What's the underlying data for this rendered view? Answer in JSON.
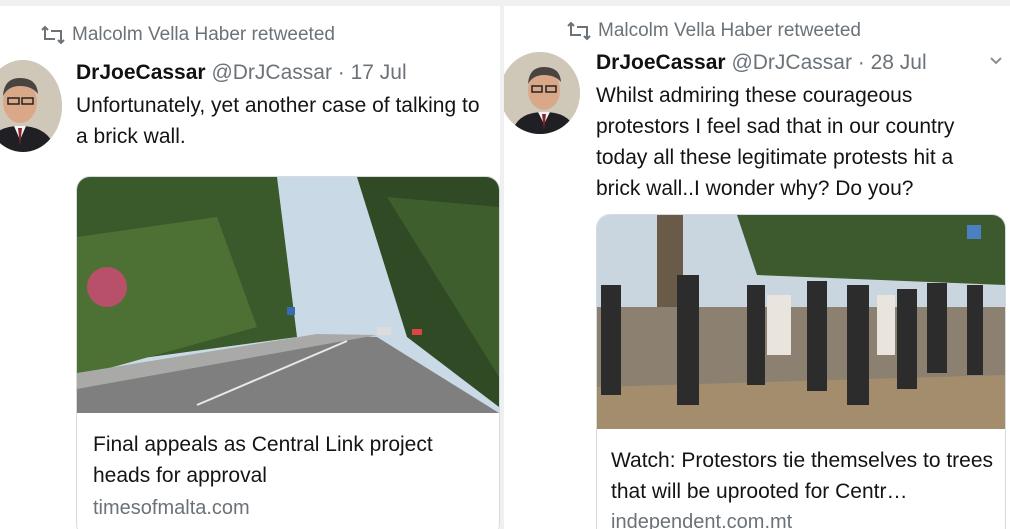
{
  "tweets": [
    {
      "retweet_label": "Malcolm Vella Haber retweeted",
      "author_name": "DrJoeCassar",
      "meta": "@DrJCassar · 17 Jul",
      "text": "Unfortunately, yet another case of talking to a brick wall.",
      "card": {
        "title": "Final appeals as Central Link project heads for approval",
        "domain": "timesofmalta.com"
      }
    },
    {
      "retweet_label": "Malcolm Vella Haber retweeted",
      "author_name": "DrJoeCassar",
      "meta": "@DrJCassar · 28 Jul",
      "text": "Whilst admiring these courageous protestors I feel sad that in our country today all these legitimate protests hit a brick wall..I wonder why? Do you?",
      "card": {
        "title": "Watch: Protestors tie themselves to trees that will be uprooted for Centr…",
        "domain": "independent.com.mt"
      }
    }
  ],
  "icons": {
    "retweet": "retweet-icon",
    "more": "chevron-down-icon",
    "external": "external-link-icon"
  },
  "colors": {
    "secondary_text": "#6b7278",
    "card_border": "#d6dade"
  }
}
